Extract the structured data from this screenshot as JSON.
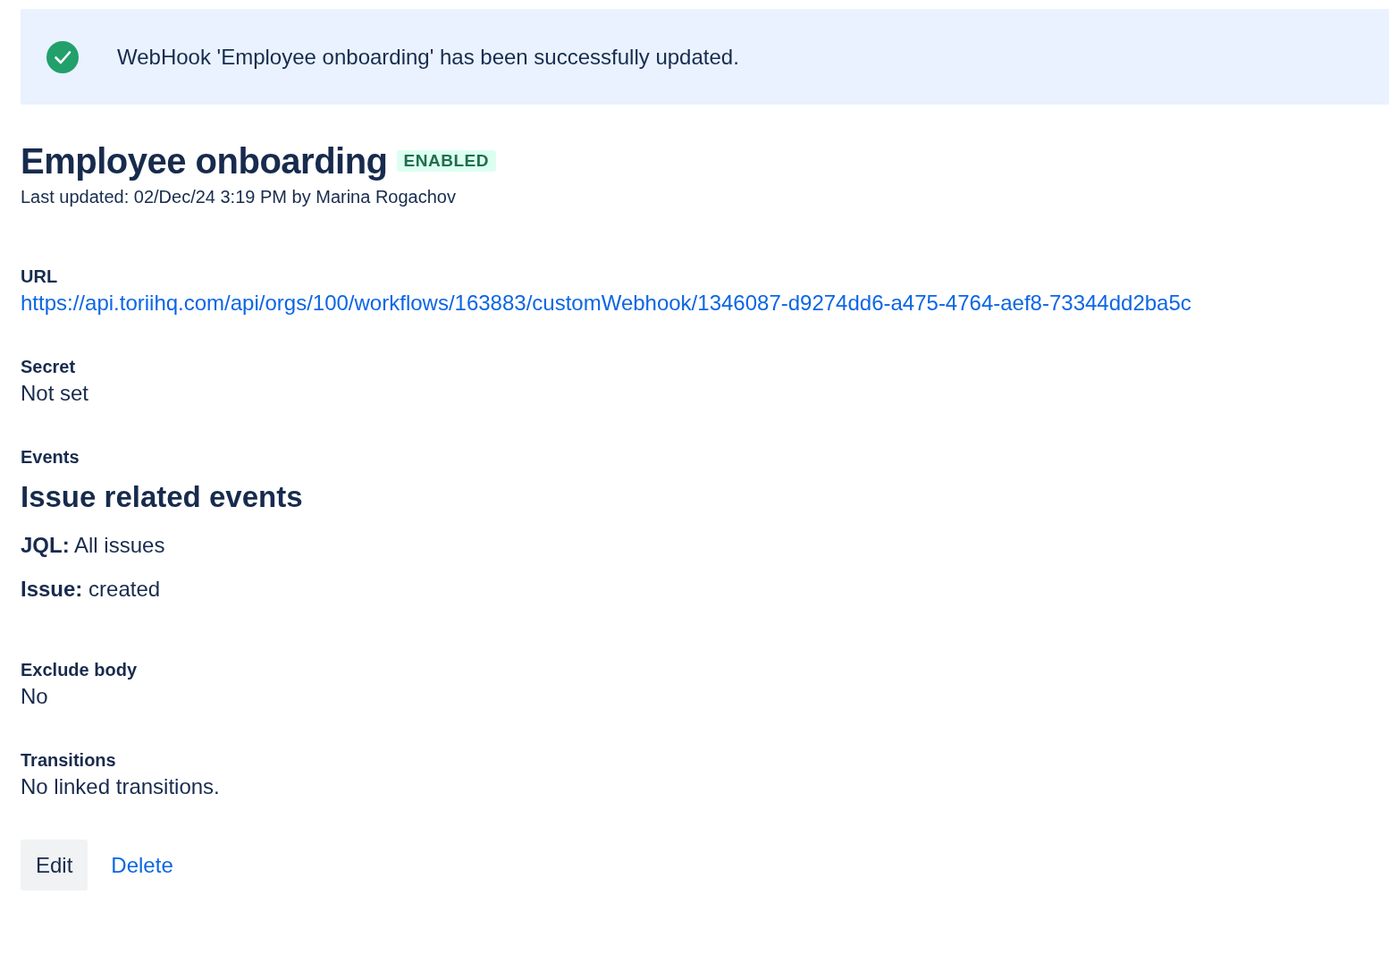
{
  "banner": {
    "kind": "success",
    "message": "WebHook 'Employee onboarding' has been successfully updated."
  },
  "webhook": {
    "title": "Employee onboarding",
    "status": {
      "label": "ENABLED",
      "enabled": true
    },
    "last_updated": "Last updated: 02/Dec/24 3:19 PM by Marina Rogachov"
  },
  "fields": [
    {
      "kind": "link",
      "label": "URL",
      "value": "https://api.toriihq.com/api/orgs/100/workflows/163883/customWebhook/1346087-d9274dd6-a475-4764-aef8-73344dd2ba5c"
    },
    {
      "kind": "text",
      "label": "Secret",
      "value": "Not set"
    },
    {
      "kind": "events",
      "label": "Events",
      "heading": "Issue related events",
      "entries": [
        "**JQL:** All issues",
        "**Issue:** created"
      ]
    },
    {
      "kind": "text",
      "label": "Exclude body",
      "value": "No"
    },
    {
      "kind": "text",
      "label": "Transitions",
      "value": "No linked transitions."
    }
  ],
  "actions": [
    {
      "kind": "button",
      "label": "Edit"
    },
    {
      "kind": "link",
      "label": "Delete"
    }
  ]
}
